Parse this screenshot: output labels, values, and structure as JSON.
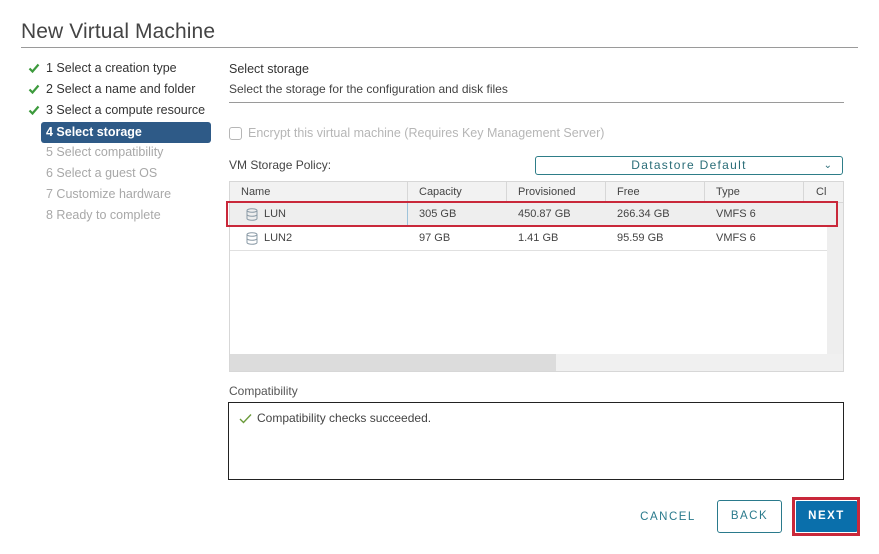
{
  "window": {
    "title": "New Virtual Machine"
  },
  "wizard": {
    "steps": [
      {
        "label": "1 Select a creation type",
        "state": "completed"
      },
      {
        "label": "2 Select a name and folder",
        "state": "completed"
      },
      {
        "label": "3 Select a compute resource",
        "state": "completed"
      },
      {
        "label": "4 Select storage",
        "state": "active"
      },
      {
        "label": "5 Select compatibility",
        "state": "pending"
      },
      {
        "label": "6 Select a guest OS",
        "state": "pending"
      },
      {
        "label": "7 Customize hardware",
        "state": "pending"
      },
      {
        "label": "8 Ready to complete",
        "state": "pending"
      }
    ]
  },
  "page": {
    "title": "Select storage",
    "description": "Select the storage for the configuration and disk files",
    "encrypt_label": "Encrypt this virtual machine (Requires Key Management Server)",
    "encrypt_checked": false,
    "policy_label": "VM Storage Policy:",
    "policy_value": "Datastore Default",
    "policy_chevron": "⌄"
  },
  "table": {
    "columns": [
      "Name",
      "Capacity",
      "Provisioned",
      "Free",
      "Type",
      "Cl"
    ],
    "rows": [
      {
        "name": "LUN",
        "capacity": "305 GB",
        "provisioned": "450.87 GB",
        "free": "266.34 GB",
        "type": "VMFS 6",
        "selected": true
      },
      {
        "name": "LUN2",
        "capacity": "97 GB",
        "provisioned": "1.41 GB",
        "free": "95.59 GB",
        "type": "VMFS 6",
        "selected": false
      }
    ],
    "row_icon": "datastore-icon"
  },
  "compatibility": {
    "label": "Compatibility",
    "message": "Compatibility checks succeeded.",
    "status": "success"
  },
  "footer": {
    "cancel_label": "CANCEL",
    "back_label": "BACK",
    "next_label": "NEXT"
  },
  "colors": {
    "active_step": "#2e5a87",
    "check_green": "#3c9a3c",
    "primary_button": "#0a6fab",
    "accent_teal": "#2a7a8c",
    "highlight_red": "#c9283a"
  }
}
